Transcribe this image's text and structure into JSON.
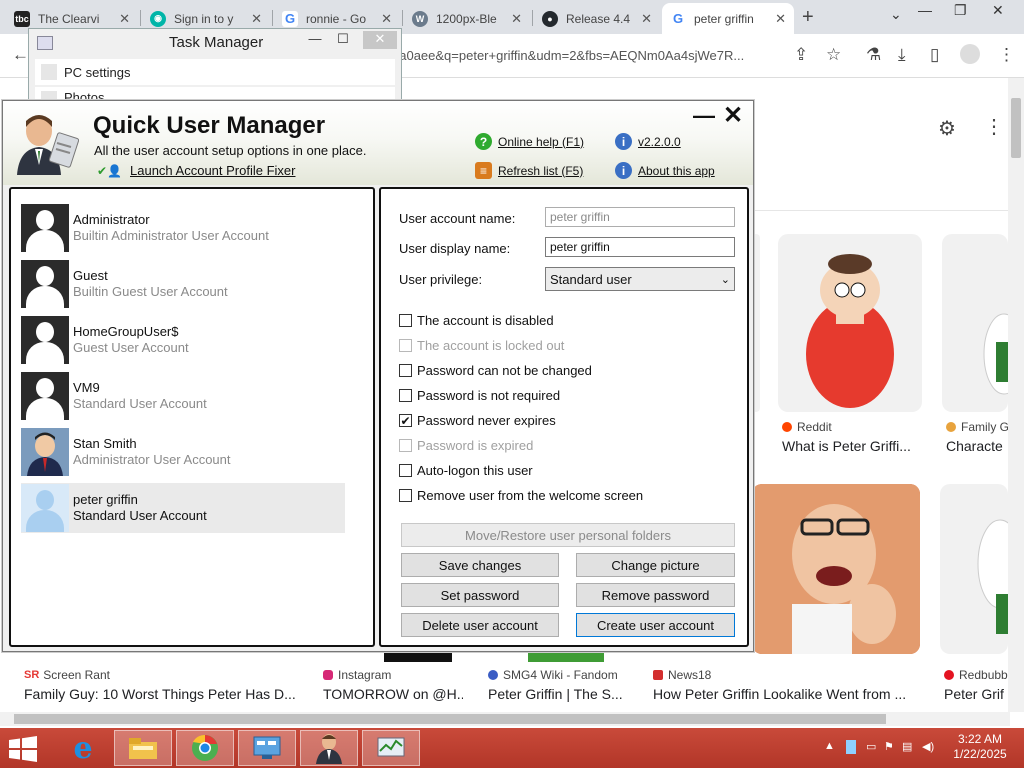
{
  "browser": {
    "tabs": [
      {
        "label": "The Clearvi",
        "icon": "tbc-icon",
        "color": "#222222"
      },
      {
        "label": "Sign in to y",
        "icon": "signin-icon",
        "color": "#00b5a8"
      },
      {
        "label": "ronnie - Go",
        "icon": "google-icon",
        "color": "#4285f4"
      },
      {
        "label": "1200px-Ble",
        "icon": "wiki-icon",
        "color": "#6b7b8c"
      },
      {
        "label": "Release 4.4",
        "icon": "github-icon",
        "color": "#24292e"
      },
      {
        "label": "peter griffin",
        "icon": "google-icon",
        "color": "#4285f4"
      }
    ],
    "new_tab": "+",
    "url": "6a0aee&q=peter+griffin&udm=2&fbs=AEQNm0Aa4sjWe7R..."
  },
  "google": {
    "results": [
      {
        "source": "Reddit",
        "caption": "What is Peter Griffi...",
        "source_color": "#ff4500"
      },
      {
        "source": "Family G",
        "caption": "Characte",
        "source_color": "#e8a33d"
      },
      {
        "source": "Screen Rant",
        "caption": "Family Guy: 10 Worst Things Peter Has D...",
        "source_color": "#e53935",
        "prefix": "SR"
      },
      {
        "source": "Instagram",
        "caption": "TOMORROW on @H...",
        "source_color": "#d62976"
      },
      {
        "source": "SMG4 Wiki - Fandom",
        "caption": "Peter Griffin | The S...",
        "source_color": "#3a5cc4"
      },
      {
        "source": "News18",
        "caption": "How Peter Griffin Lookalike Went from ...",
        "source_color": "#d32f2f"
      },
      {
        "source": "Redbubb",
        "caption": "Peter Grif",
        "source_color": "#e41321"
      }
    ]
  },
  "task_manager": {
    "title": "Task Manager",
    "minimize": "—",
    "maximize": "☐",
    "close": "✕",
    "items": [
      "PC settings",
      "Photos"
    ]
  },
  "qum": {
    "title": "Quick User Manager",
    "subtitle": "All the user account setup options in one place.",
    "launch_fixer": "Launch Account Profile Fixer",
    "online_help": "Online help (F1)",
    "version": "v2.2.0.0",
    "refresh": "Refresh list (F5)",
    "about": "About this app",
    "minimize": "—",
    "close": "✕",
    "users": [
      {
        "name": "Administrator",
        "desc": "Builtin Administrator User Account",
        "avatar": "default"
      },
      {
        "name": "Guest",
        "desc": "Builtin Guest User Account",
        "avatar": "default"
      },
      {
        "name": "HomeGroupUser$",
        "desc": "Guest User Account",
        "avatar": "default"
      },
      {
        "name": "VM9",
        "desc": "Standard User Account",
        "avatar": "default"
      },
      {
        "name": "Stan Smith",
        "desc": "Administrator User Account",
        "avatar": "stan"
      },
      {
        "name": "peter griffin",
        "desc": "Standard User Account",
        "avatar": "light",
        "selected": true
      }
    ],
    "form": {
      "account_name_label": "User account name:",
      "account_name_value": "peter griffin",
      "display_name_label": "User display name:",
      "display_name_value": "peter griffin",
      "privilege_label": "User privilege:",
      "privilege_value": "Standard user"
    },
    "checkboxes": [
      {
        "label": "The account is disabled",
        "checked": false,
        "disabled": false
      },
      {
        "label": "The account is locked out",
        "checked": false,
        "disabled": true
      },
      {
        "label": "Password can not be changed",
        "checked": false,
        "disabled": false
      },
      {
        "label": "Password is not required",
        "checked": false,
        "disabled": false
      },
      {
        "label": "Password never expires",
        "checked": true,
        "disabled": false
      },
      {
        "label": "Password is expired",
        "checked": false,
        "disabled": true
      },
      {
        "label": "Auto-logon this user",
        "checked": false,
        "disabled": false
      },
      {
        "label": "Remove user from the welcome screen",
        "checked": false,
        "disabled": false
      }
    ],
    "buttons": {
      "move_restore": "Move/Restore user personal folders",
      "save": "Save changes",
      "change_picture": "Change picture",
      "set_password": "Set password",
      "remove_password": "Remove password",
      "delete": "Delete user account",
      "create": "Create user account"
    }
  },
  "taskbar": {
    "time": "3:22 AM",
    "date": "1/22/2025"
  }
}
